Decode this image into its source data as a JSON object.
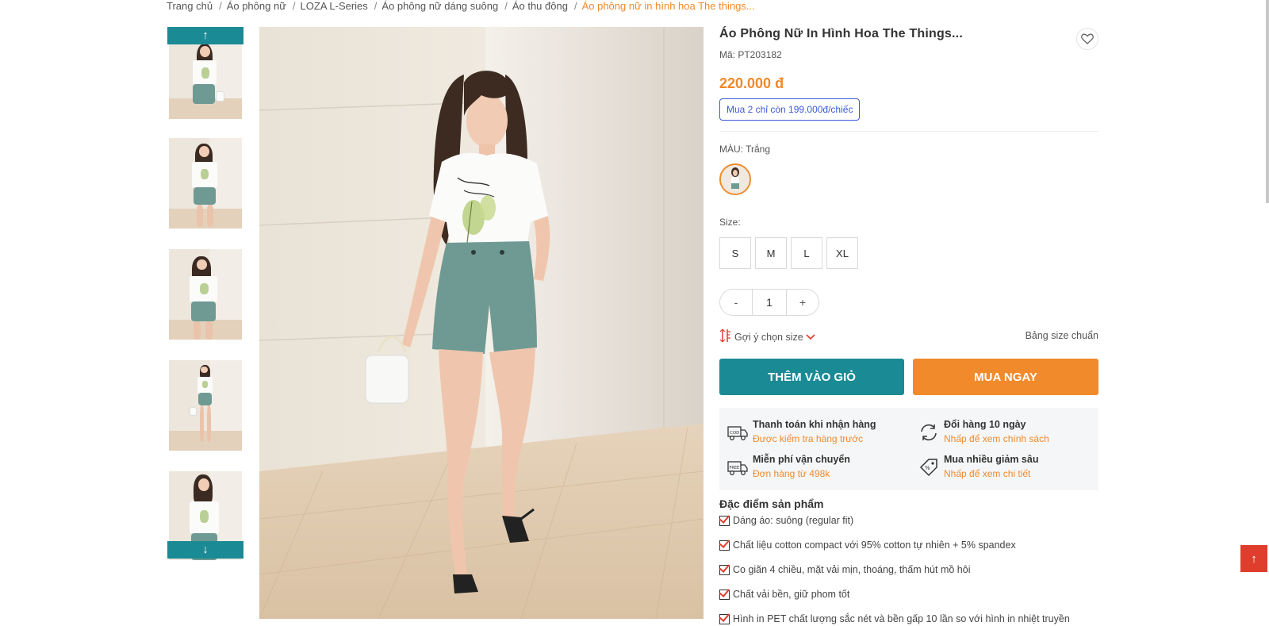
{
  "breadcrumb": {
    "items": [
      "Trang chủ",
      "Áo phông nữ",
      "LOZA L-Series",
      "Áo phông nữ dáng suông",
      "Áo thu đông"
    ],
    "current": "Áo phông nữ in hình hoa The things..."
  },
  "gallery": {
    "up_arrow": "↑",
    "down_arrow": "↓",
    "thumbnail_count": 5
  },
  "product": {
    "title": "Áo Phông Nữ In Hình Hoa The Things...",
    "sku": "Mã: PT203182",
    "price": "220.000 đ",
    "promo": "Mua 2 chỉ còn 199.000đ/chiếc",
    "color_label": "MÀU: Trắng",
    "size_label": "Size:",
    "sizes": [
      "S",
      "M",
      "L",
      "XL"
    ],
    "quantity": {
      "minus": "-",
      "value": "1",
      "plus": "+"
    },
    "size_suggest": "Gợi ý chọn size",
    "size_chart": "Bảng size chuẩn",
    "add_to_cart": "THÊM VÀO GIỎ",
    "buy_now": "MUA NGAY"
  },
  "benefits": [
    {
      "icon": "cod-truck-icon",
      "title": "Thanh toán khi nhận hàng",
      "subtitle": "Được kiểm tra hàng trước"
    },
    {
      "icon": "exchange-icon",
      "title": "Đổi hàng 10 ngày",
      "subtitle": "Nhấp để xem chính sách"
    },
    {
      "icon": "free-shipping-icon",
      "title": "Miễn phí vận chuyển",
      "subtitle": "Đơn hàng từ 498k"
    },
    {
      "icon": "discount-tag-icon",
      "title": "Mua nhiều giảm sâu",
      "subtitle": "Nhấp để xem chi tiết"
    }
  ],
  "features": {
    "title": "Đặc điểm sản phẩm",
    "items": [
      "Dáng áo: suông (regular fit)",
      "Chất liệu cotton compact với 95% cotton tự nhiên + 5% spandex",
      "Co giãn 4 chiều, mặt vải mịn, thoáng, thấm hút mồ hôi",
      "Chất vải bền, giữ phom tốt",
      "Hình in PET chất lượng sắc nét và bền gấp 10 lần so với hình in nhiệt truyền"
    ]
  },
  "scroll_top": "↑",
  "colors": {
    "teal": "#1a8a94",
    "orange": "#f08a2b",
    "promo_blue": "#3b5bdb",
    "scroll_top_red": "#e03e2d"
  }
}
